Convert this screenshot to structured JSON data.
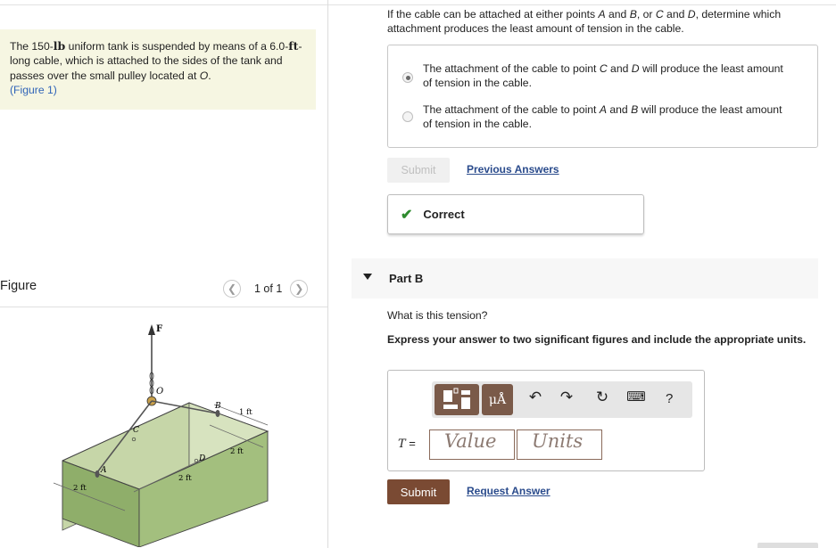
{
  "problem": {
    "text_1": "The 150-",
    "unit_lb": "lb",
    "text_2": " uniform tank is suspended by means of a ",
    "length": "6.0-",
    "unit_ft": "ft",
    "text_3": "-long cable, which is attached to the sides of the tank and passes over the small pulley located at ",
    "point_o": "O",
    "text_4": ".",
    "figure_link": "(Figure 1)"
  },
  "figure": {
    "heading": "Figure",
    "count": "1 of 1",
    "labels": {
      "F": "F",
      "O": "O",
      "B": "B",
      "C": "C",
      "D": "D",
      "A": "A",
      "dim_1ft": "1 ft",
      "dim_2ft_right": "2 ft",
      "dim_2ft_mid": "2 ft",
      "dim_2ft_left": "2 ft"
    }
  },
  "part_a": {
    "question_1": "If the cable can be attached at either points ",
    "q_a": "A",
    "question_2": " and ",
    "q_b": "B",
    "question_3": ", or ",
    "q_c": "C",
    "question_4": " and ",
    "q_d": "D",
    "question_5": ", determine which attachment produces the least amount of tension in the cable.",
    "options": [
      {
        "t1": "The attachment of the cable to point ",
        "p1": "C",
        "t2": " and ",
        "p2": "D",
        "t3": " will produce the least amount of tension in the cable.",
        "selected": true
      },
      {
        "t1": "The attachment of the cable to point ",
        "p1": "A",
        "t2": " and ",
        "p2": "B",
        "t3": " will produce the least amount of tension in the cable.",
        "selected": false
      }
    ],
    "submit_label": "Submit",
    "previous_answers_label": "Previous Answers",
    "feedback": "Correct"
  },
  "part_b": {
    "label": "Part B",
    "question": "What is this tension?",
    "instructions": "Express your answer to two significant figures and include the appropriate units.",
    "toolbar": {
      "mu_label": "μÅ",
      "help_label": "?"
    },
    "variable": "T",
    "equals": " =",
    "value_placeholder": "Value",
    "units_placeholder": "Units",
    "submit_label": "Submit",
    "request_answer_label": "Request Answer"
  },
  "colors": {
    "accent_brown": "#7a4a33",
    "toolbar_brown": "#7a5a49",
    "link_blue": "#2a4b8c",
    "correct_green": "#2e8b2e",
    "problem_bg": "#f6f6e2",
    "tank_green": "#8fae6a"
  }
}
